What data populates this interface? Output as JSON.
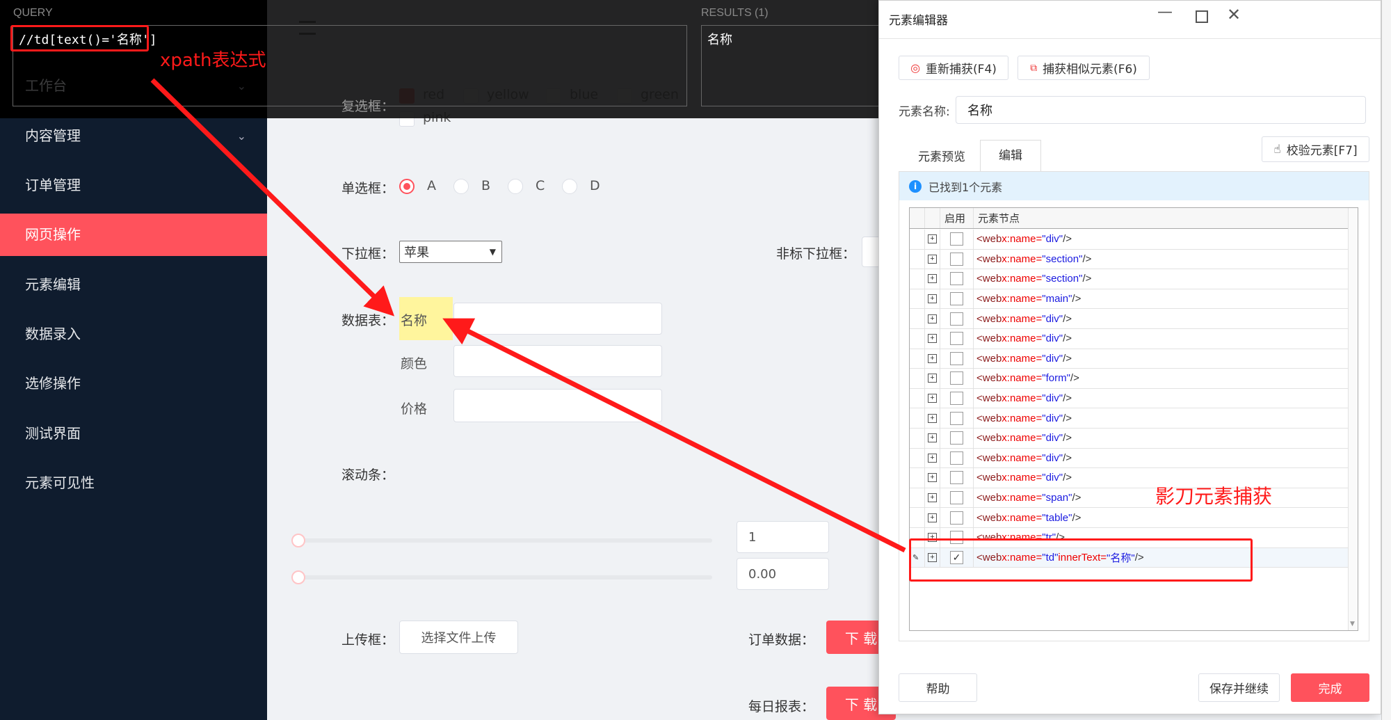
{
  "sidebar": {
    "items": [
      {
        "label": "工作台",
        "chevron": true
      },
      {
        "label": "内容管理",
        "chevron": true
      },
      {
        "label": "订单管理"
      },
      {
        "label": "网页操作",
        "active": true
      },
      {
        "label": "元素编辑"
      },
      {
        "label": "数据录入"
      },
      {
        "label": "选修操作"
      },
      {
        "label": "测试界面"
      },
      {
        "label": "元素可见性"
      }
    ]
  },
  "query_panel": {
    "query_label": "QUERY",
    "query_value": "//td[text()='名称']",
    "results_label": "RESULTS (1)",
    "result_value": "名称"
  },
  "form": {
    "checkbox_label": "复选框：",
    "checkboxes": [
      {
        "label": "red",
        "checked": true
      },
      {
        "label": "yellow"
      },
      {
        "label": "blue"
      },
      {
        "label": "green"
      },
      {
        "label": "pink"
      }
    ],
    "radio_label": "单选框：",
    "radios": [
      {
        "label": "A",
        "checked": true
      },
      {
        "label": "B"
      },
      {
        "label": "C"
      },
      {
        "label": "D"
      }
    ],
    "select_label": "下拉框：",
    "select_value": "苹果",
    "custom_select_label": "非标下拉框：",
    "table_label": "数据表：",
    "table_rows": [
      "名称",
      "颜色",
      "价格"
    ],
    "scroll_label": "滚动条：",
    "slider1_value": "1",
    "slider2_value": "0.00",
    "upload_label": "上传框：",
    "upload_button": "选择文件上传",
    "order_label": "订单数据：",
    "daily_label": "每日报表：",
    "download_button": "下 载"
  },
  "dialog": {
    "title": "元素编辑器",
    "recapture": "重新捕获(F4)",
    "capture_similar": "捕获相似元素(F6)",
    "name_label": "元素名称:",
    "name_value": "名称",
    "tabs": [
      "元素预览",
      "编辑"
    ],
    "active_tab": 1,
    "verify": "校验元素[F7]",
    "info": "已找到1个元素",
    "grid_headers": [
      "启用",
      "元素节点"
    ],
    "nodes": [
      {
        "tag": "web",
        "name": "div"
      },
      {
        "tag": "web",
        "name": "section"
      },
      {
        "tag": "web",
        "name": "section"
      },
      {
        "tag": "web",
        "name": "main"
      },
      {
        "tag": "web",
        "name": "div"
      },
      {
        "tag": "web",
        "name": "div"
      },
      {
        "tag": "web",
        "name": "div"
      },
      {
        "tag": "web",
        "name": "form"
      },
      {
        "tag": "web",
        "name": "div"
      },
      {
        "tag": "web",
        "name": "div"
      },
      {
        "tag": "web",
        "name": "div"
      },
      {
        "tag": "web",
        "name": "div"
      },
      {
        "tag": "web",
        "name": "div"
      },
      {
        "tag": "web",
        "name": "span"
      },
      {
        "tag": "web",
        "name": "table"
      },
      {
        "tag": "web",
        "name": "tr"
      },
      {
        "tag": "web",
        "name": "td",
        "innerText": "名称",
        "checked": true,
        "selected": true
      }
    ],
    "help": "帮助",
    "save_continue": "保存并继续",
    "done": "完成"
  },
  "annotations": {
    "xpath": "xpath表达式",
    "capture": "影刀元素捕获"
  },
  "colors": {
    "accent": "#ff525c",
    "sidebar": "#0f1c2e",
    "annotation": "#ff1a1a"
  }
}
